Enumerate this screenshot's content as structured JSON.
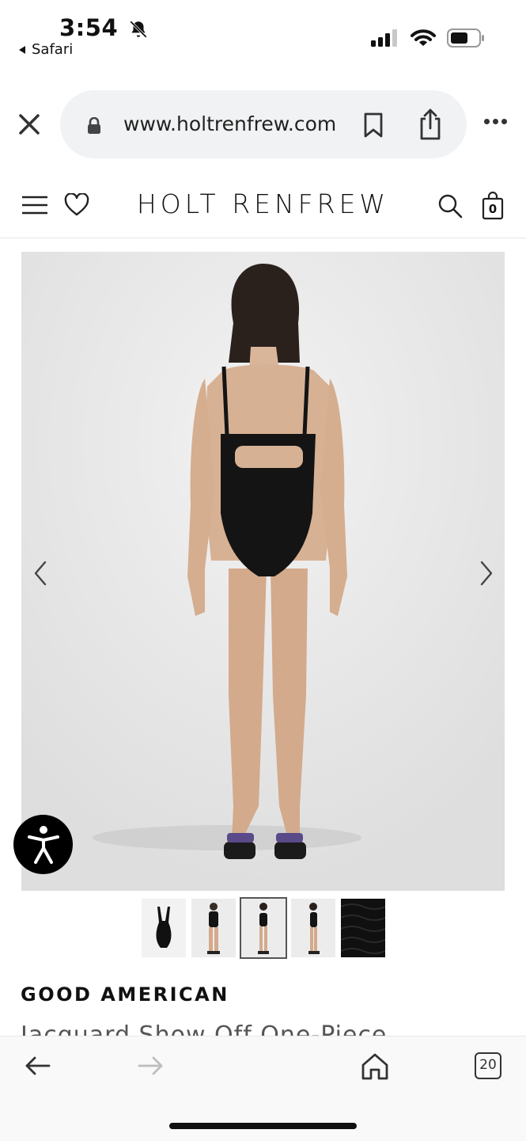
{
  "status_bar": {
    "time": "3:54",
    "back_app": "Safari",
    "icons": [
      "bell-slash-icon",
      "signal-icon",
      "wifi-icon",
      "battery-icon"
    ]
  },
  "browser": {
    "url": "www.holtrenfrew.com",
    "tab_count": "20"
  },
  "site": {
    "brand": "HOLT RENFREW",
    "cart_count": "0"
  },
  "product": {
    "brand": "GOOD AMERICAN",
    "title": "Jacquard Show Off One-Piece",
    "thumbnails": [
      "swimsuit-flat",
      "front-view",
      "back-view",
      "side-view",
      "fabric-detail"
    ],
    "selected_thumbnail": 2
  },
  "colors": {
    "accent": "#111111",
    "pill": "#f1f2f4",
    "toolbar": "#f9f9f9"
  }
}
